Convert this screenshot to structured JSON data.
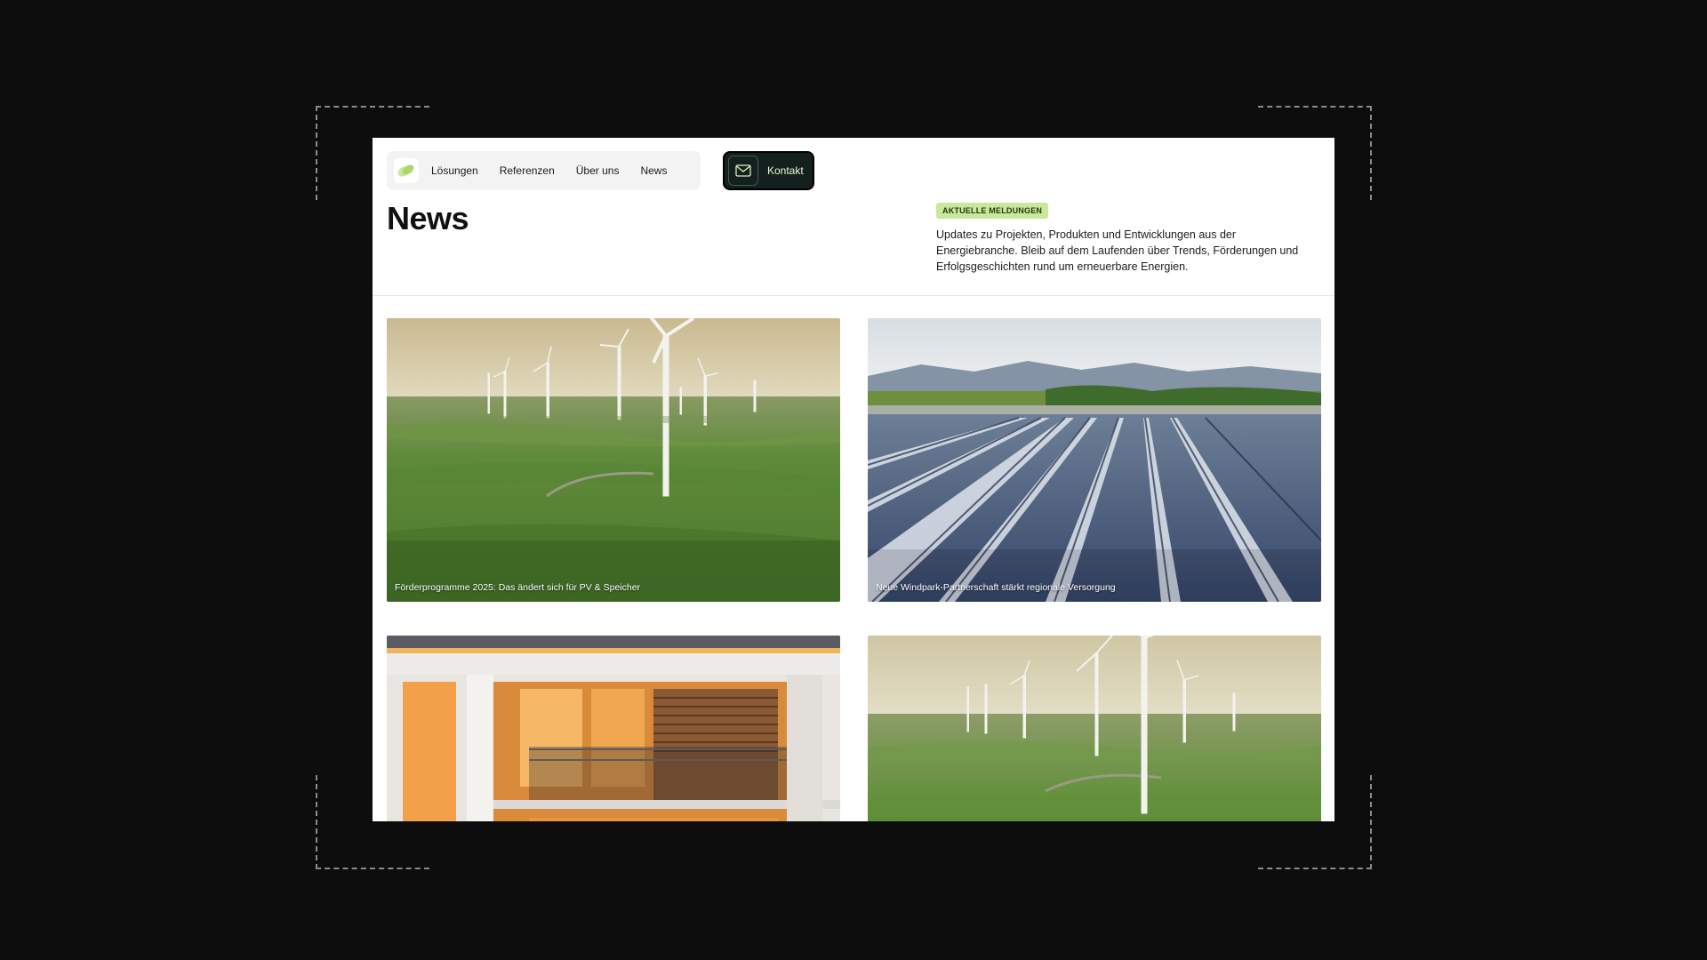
{
  "nav": {
    "items": [
      {
        "label": "Lösungen"
      },
      {
        "label": "Referenzen"
      },
      {
        "label": "Über uns"
      },
      {
        "label": "News"
      }
    ],
    "contact_label": "Kontakt"
  },
  "header": {
    "title": "News",
    "badge": "AKTUELLE MELDUNGEN",
    "intro": "Updates zu Projekten, Produkten und Entwicklungen aus der Energiebranche. Bleib auf dem Laufenden über Trends, Förderungen und Erfolgsgeschichten rund um erneuerbare Energien."
  },
  "cards": [
    {
      "caption": "Förderprogramme 2025: Das ändert sich für PV & Speicher"
    },
    {
      "caption": "Neue Windpark-Partnerschaft stärkt regionale Versorgung"
    },
    {
      "caption": ""
    },
    {
      "caption": ""
    }
  ],
  "colors": {
    "background": "#0d0d0d",
    "badge": "#c8e89a",
    "contact_button": "#13201d",
    "logo_accent": "#a6d96a"
  }
}
